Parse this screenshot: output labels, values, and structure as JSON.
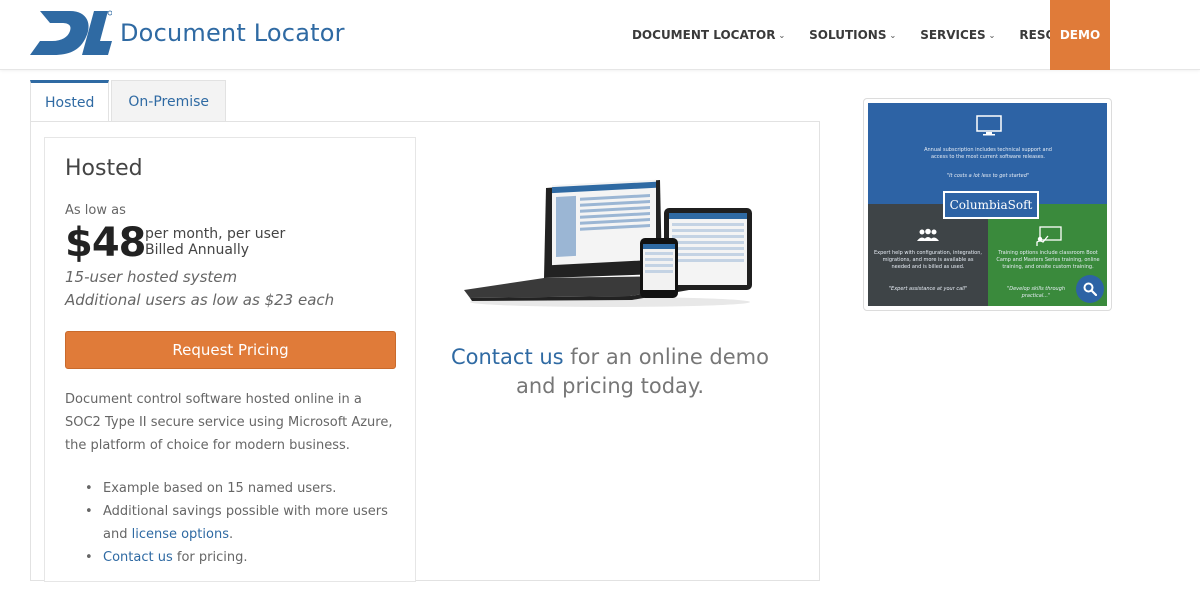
{
  "header": {
    "logo_text": "Document Locator",
    "nav": [
      {
        "label": "DOCUMENT LOCATOR"
      },
      {
        "label": "SOLUTIONS"
      },
      {
        "label": "SERVICES"
      },
      {
        "label": "RESOURCES"
      }
    ],
    "demo_label": "DEMO"
  },
  "tabs": [
    {
      "label": "Hosted",
      "active": true
    },
    {
      "label": "On-Premise",
      "active": false
    }
  ],
  "card": {
    "title": "Hosted",
    "low_label": "As low as",
    "price": "$48",
    "price_line1": "per month, per user",
    "price_line2": "Billed Annually",
    "italic1": "15-user hosted system",
    "italic2": "Additional users as low as $23 each",
    "button_label": "Request Pricing",
    "description": "Document control software hosted online in a SOC2 Type II secure service using Microsoft Azure, the platform of choice for modern business.",
    "bullet1": "Example based on 15 named users.",
    "bullet2_prefix": "Additional savings possible with more users and ",
    "bullet2_link": "license options",
    "bullet2_suffix": ".",
    "bullet3_link": "Contact us",
    "bullet3_suffix": " for pricing."
  },
  "center": {
    "contact_link": "Contact us",
    "contact_rest": " for an online demo and pricing today."
  },
  "thumbnail": {
    "top_text": "Annual subscription includes technical support and access to the most current software releases.",
    "top_quote": "\"It costs a lot less to get started\"",
    "badge": "ColumbiaSoft",
    "left_text": "Expert help with configuration, integration, migrations, and more is available as needed and is billed as used.",
    "left_quote": "\"Expert assistance at your call\"",
    "right_text": "Training options include classroom Boot Camp and Masters Series training, online training, and onsite custom training.",
    "right_quote": "\"Develop skills through practical...\""
  },
  "colors": {
    "brand_blue": "#2f6aa3",
    "accent_orange": "#e07b39",
    "thumb_blue": "#2d63a5",
    "thumb_gray": "#3e4447",
    "thumb_green": "#3a8a3c"
  },
  "icons": [
    "chevron-down-icon",
    "monitor-icon",
    "people-icon",
    "whiteboard-icon",
    "search-icon"
  ]
}
